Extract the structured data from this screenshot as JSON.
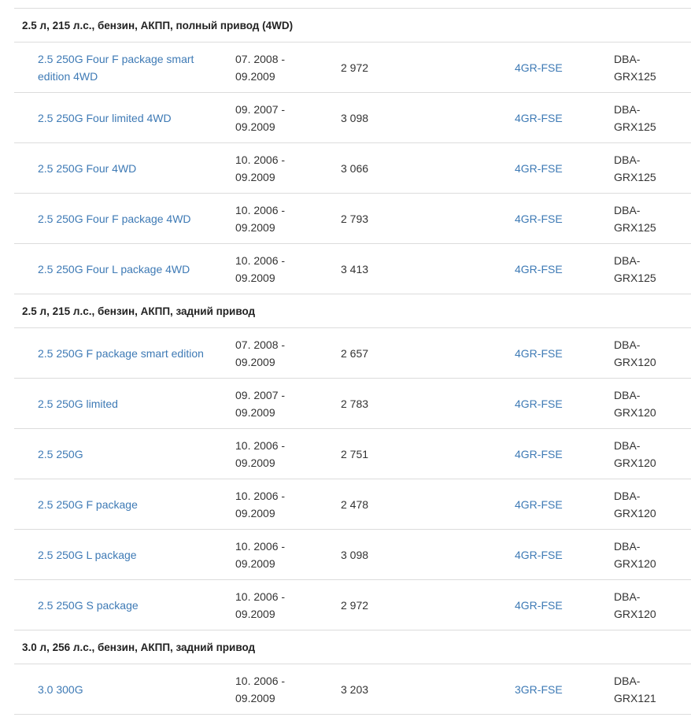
{
  "groups": [
    {
      "header": "2.5 л, 215 л.с., бензин, АКПП, полный привод (4WD)",
      "rows": [
        {
          "name": "2.5 250G Four F package smart edition 4WD",
          "date": "07. 2008  -\n09.2009",
          "price": "2 972",
          "engine": "4GR-FSE",
          "body": "DBA-\nGRX125"
        },
        {
          "name": "2.5 250G Four limited 4WD",
          "date": "09. 2007  -\n09.2009",
          "price": "3 098",
          "engine": "4GR-FSE",
          "body": "DBA-\nGRX125"
        },
        {
          "name": "2.5 250G Four 4WD",
          "date": "10. 2006  -\n09.2009",
          "price": "3 066",
          "engine": "4GR-FSE",
          "body": "DBA-\nGRX125"
        },
        {
          "name": "2.5 250G Four F package 4WD",
          "date": "10. 2006  -\n09.2009",
          "price": "2 793",
          "engine": "4GR-FSE",
          "body": "DBA-\nGRX125"
        },
        {
          "name": "2.5 250G Four L package 4WD",
          "date": "10. 2006  -\n09.2009",
          "price": "3 413",
          "engine": "4GR-FSE",
          "body": "DBA-\nGRX125"
        }
      ]
    },
    {
      "header": "2.5 л, 215 л.с., бензин, АКПП, задний привод",
      "rows": [
        {
          "name": "2.5 250G F package smart edition",
          "date": "07. 2008  -\n09.2009",
          "price": "2 657",
          "engine": "4GR-FSE",
          "body": "DBA-\nGRX120"
        },
        {
          "name": "2.5 250G limited",
          "date": "09. 2007  -\n09.2009",
          "price": "2 783",
          "engine": "4GR-FSE",
          "body": "DBA-\nGRX120"
        },
        {
          "name": "2.5 250G",
          "date": "10. 2006  -\n09.2009",
          "price": "2 751",
          "engine": "4GR-FSE",
          "body": "DBA-\nGRX120"
        },
        {
          "name": "2.5 250G F package",
          "date": "10. 2006  -\n09.2009",
          "price": "2 478",
          "engine": "4GR-FSE",
          "body": "DBA-\nGRX120"
        },
        {
          "name": "2.5 250G L package",
          "date": "10. 2006  -\n09.2009",
          "price": "3 098",
          "engine": "4GR-FSE",
          "body": "DBA-\nGRX120"
        },
        {
          "name": "2.5 250G S package",
          "date": "10. 2006  -\n09.2009",
          "price": "2 972",
          "engine": "4GR-FSE",
          "body": "DBA-\nGRX120"
        }
      ]
    },
    {
      "header": "3.0 л, 256 л.с., бензин, АКПП, задний привод",
      "rows": [
        {
          "name": "3.0 300G",
          "date": "10. 2006  -\n09.2009",
          "price": "3 203",
          "engine": "3GR-FSE",
          "body": "DBA-\nGRX121"
        }
      ]
    }
  ]
}
